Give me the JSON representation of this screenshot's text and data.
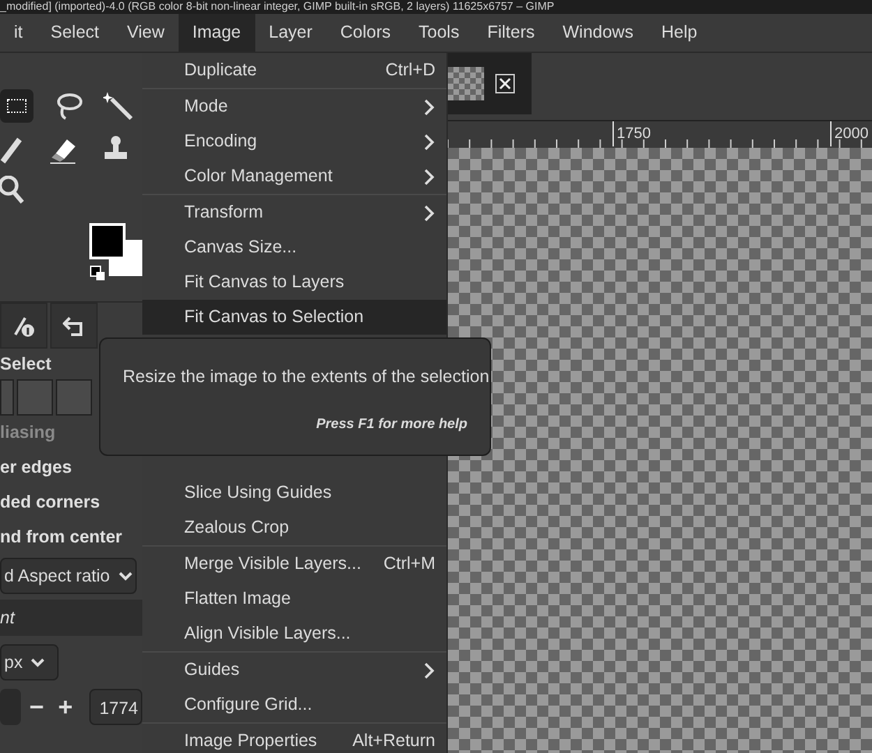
{
  "window": {
    "title": "_modified] (imported)-4.0 (RGB color 8-bit non-linear integer, GIMP built-in sRGB, 2 layers) 11625x6757 – GIMP"
  },
  "menubar": [
    {
      "label": "it",
      "selected": false
    },
    {
      "label": "Select",
      "selected": false
    },
    {
      "label": "View",
      "selected": false
    },
    {
      "label": "Image",
      "selected": true
    },
    {
      "label": "Layer",
      "selected": false
    },
    {
      "label": "Colors",
      "selected": false
    },
    {
      "label": "Tools",
      "selected": false
    },
    {
      "label": "Filters",
      "selected": false
    },
    {
      "label": "Windows",
      "selected": false
    },
    {
      "label": "Help",
      "selected": false
    }
  ],
  "image_menu": {
    "groups": [
      [
        {
          "label": "Duplicate",
          "shortcut": "Ctrl+D",
          "submenu": false,
          "selected": false
        }
      ],
      [
        {
          "label": "Mode",
          "submenu": true,
          "selected": false
        },
        {
          "label": "Encoding",
          "submenu": true,
          "selected": false
        },
        {
          "label": "Color Management",
          "submenu": true,
          "selected": false
        }
      ],
      [
        {
          "label": "Transform",
          "submenu": true,
          "selected": false
        },
        {
          "label": "Canvas Size...",
          "submenu": false,
          "selected": false
        },
        {
          "label": "Fit Canvas to Layers",
          "submenu": false,
          "selected": false
        },
        {
          "label": "Fit Canvas to Selection",
          "submenu": false,
          "selected": true
        },
        {
          "kind": "hidden"
        },
        {
          "label": "Slice Using Guides",
          "submenu": false,
          "selected": false
        },
        {
          "label": "Zealous Crop",
          "submenu": false,
          "selected": false
        }
      ],
      [
        {
          "label": "Merge Visible Layers...",
          "shortcut": "Ctrl+M",
          "submenu": false,
          "selected": false
        },
        {
          "label": "Flatten Image",
          "submenu": false,
          "selected": false
        },
        {
          "label": "Align Visible Layers...",
          "submenu": false,
          "selected": false
        }
      ],
      [
        {
          "label": "Guides",
          "submenu": true,
          "selected": false
        },
        {
          "label": "Configure Grid...",
          "submenu": false,
          "selected": false
        }
      ],
      [
        {
          "label": "Image Properties",
          "shortcut": "Alt+Return",
          "submenu": false,
          "selected": false
        }
      ]
    ]
  },
  "tooltip": {
    "text": "Resize the image to the extents of the selection",
    "help": "Press F1 for more help"
  },
  "tool_options": {
    "title": "Select",
    "options": [
      {
        "label": "liasing",
        "disabled": true
      },
      {
        "label": "er edges",
        "disabled": false
      },
      {
        "label": "ded corners",
        "disabled": false
      },
      {
        "label": "nd from center",
        "disabled": false
      }
    ],
    "aspect_dropdown": "d Aspect ratio",
    "section": "nt",
    "unit_dropdown": "px",
    "value_field": "1774",
    "minus": "−",
    "plus": "+"
  },
  "ruler": {
    "labels": [
      "1750",
      "2000"
    ]
  }
}
